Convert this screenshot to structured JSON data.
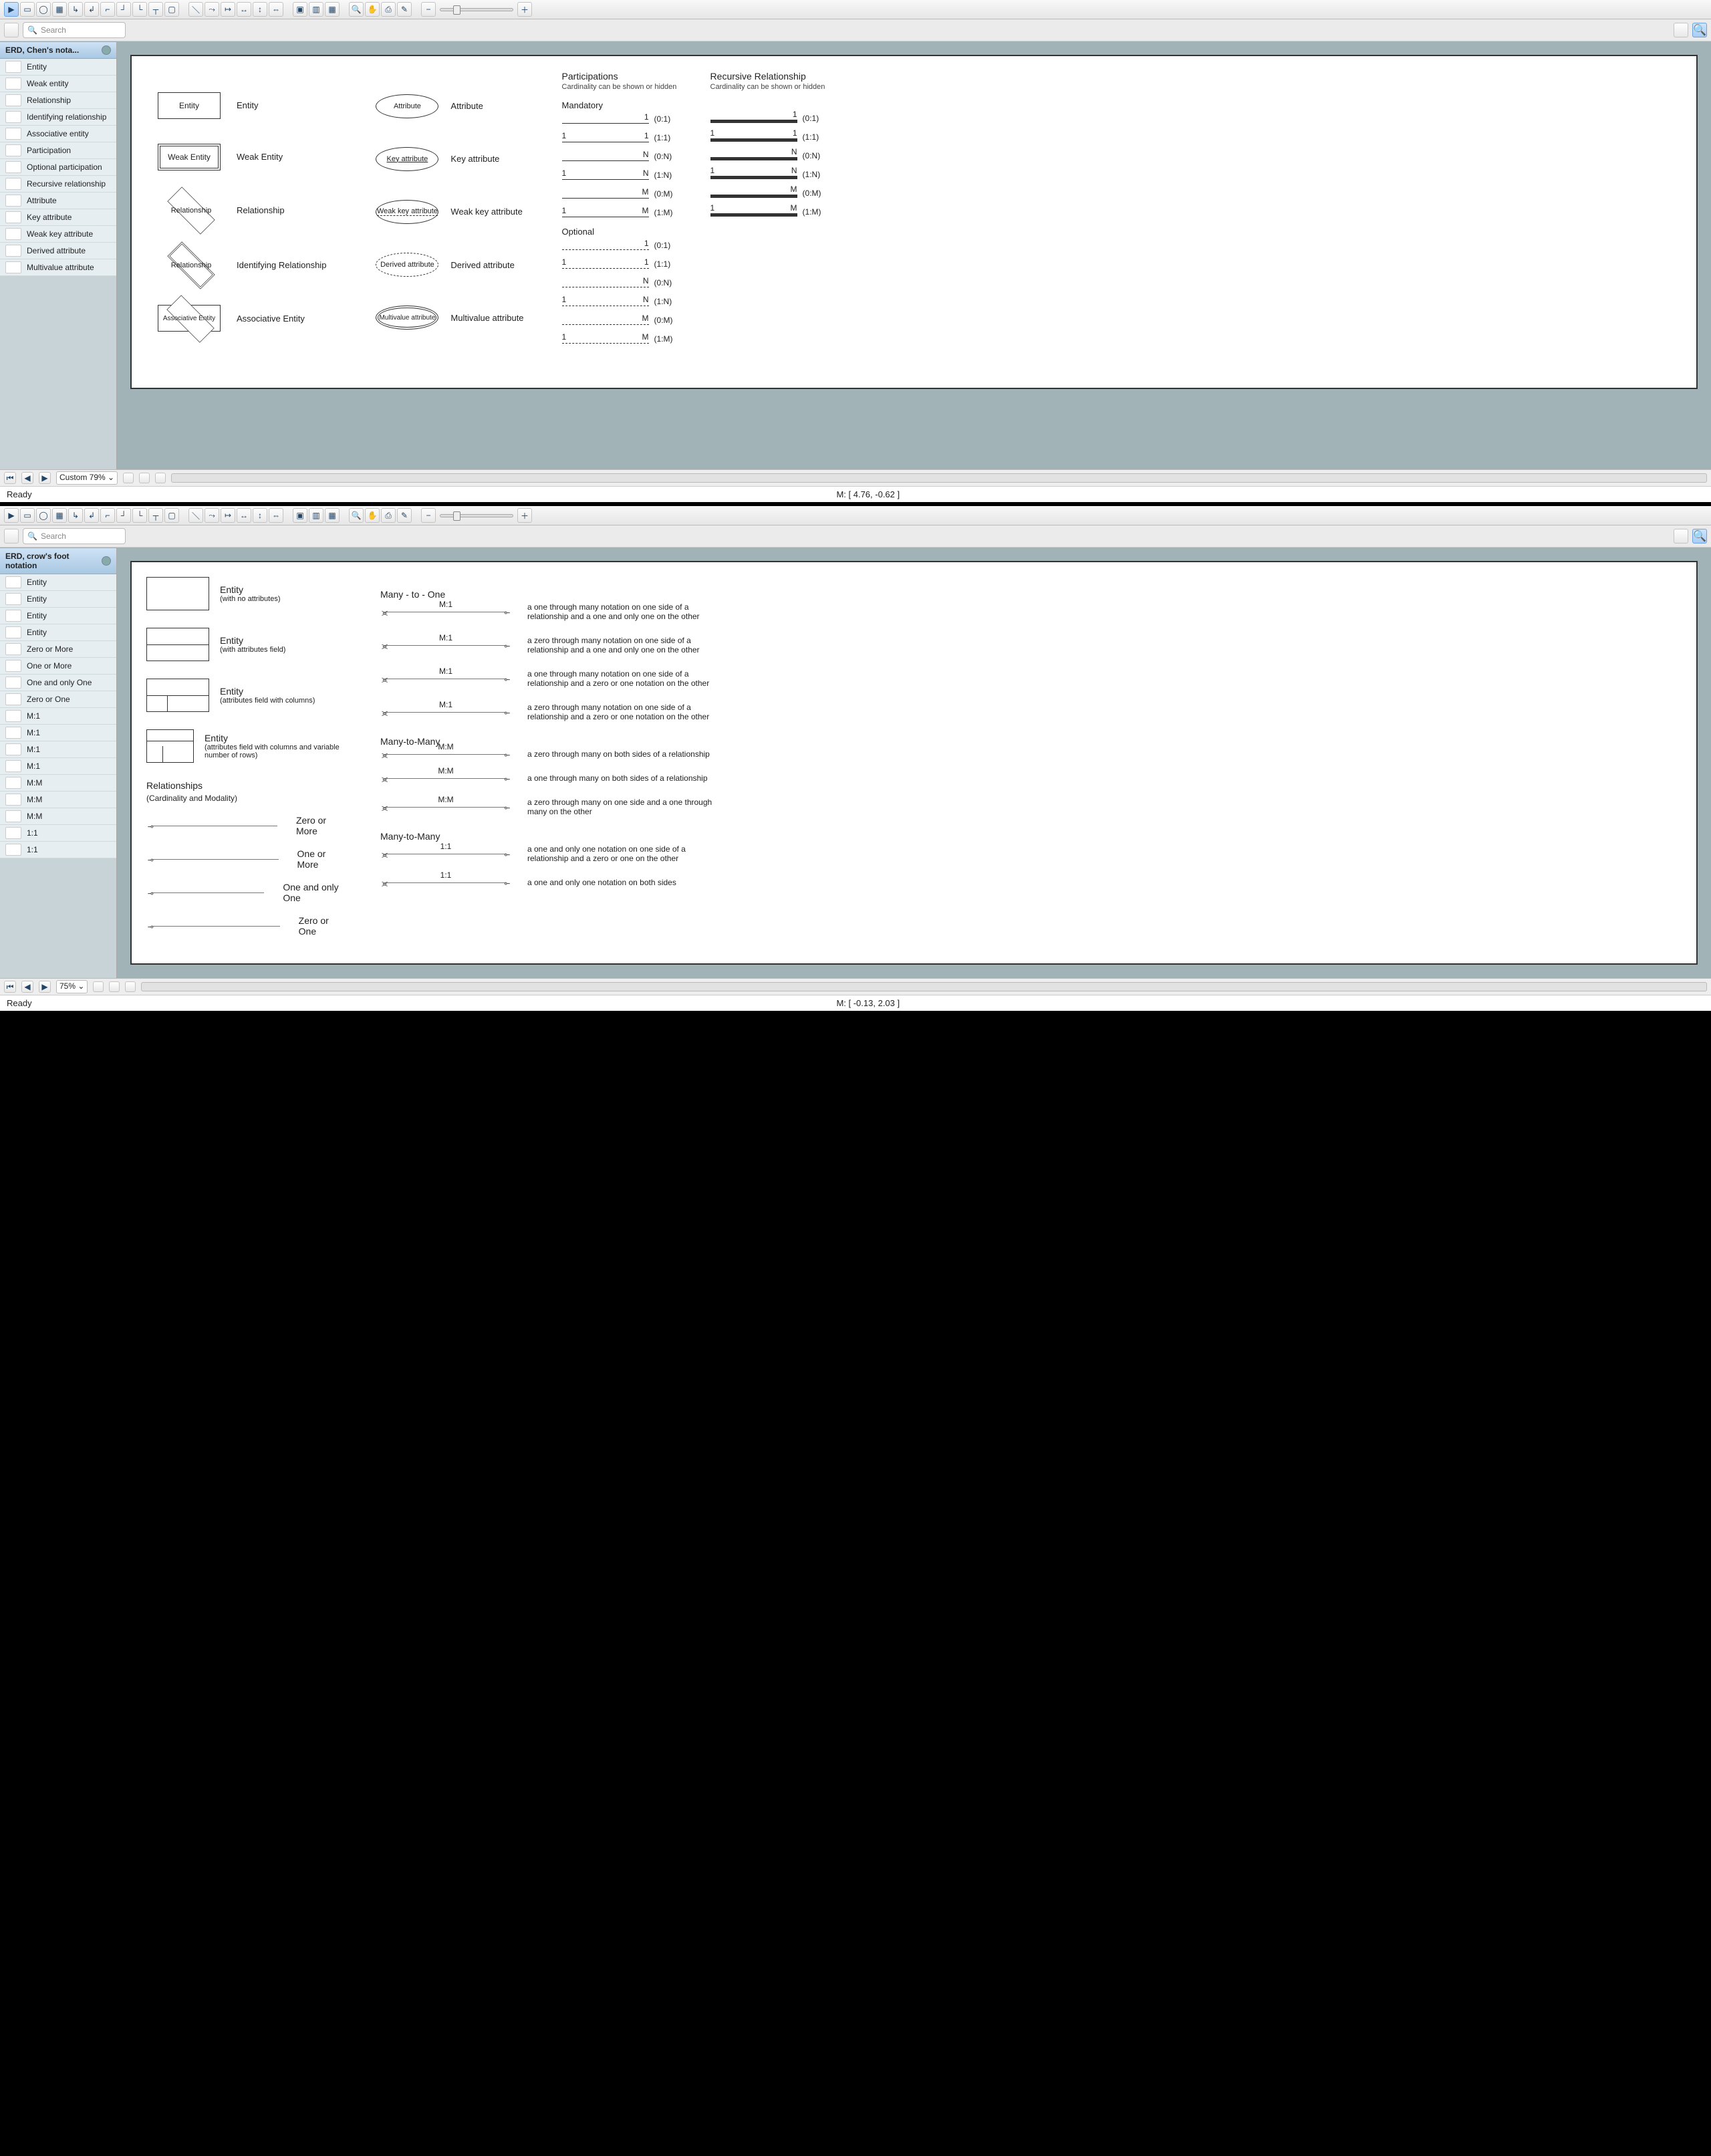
{
  "top": {
    "search_placeholder": "Search",
    "panel1_title": "ERD, Chen's nota...",
    "panel1_items": [
      "Entity",
      "Weak entity",
      "Relationship",
      "Identifying relationship",
      "Associative entity",
      "Participation",
      "Optional participation",
      "Recursive relationship",
      "Attribute",
      "Key attribute",
      "Weak key attribute",
      "Derived attribute",
      "Multivalue attribute"
    ],
    "zoom_label": "Custom 79%",
    "status_left": "Ready",
    "status_mid": "M: [ 4.76, -0.62 ]"
  },
  "canvas1": {
    "e1": "Entity",
    "l1": "Entity",
    "e2": "Weak Entity",
    "l2": "Weak Entity",
    "e3": "Relationship",
    "l3": "Relationship",
    "e4": "Relationship",
    "l4": "Identifying Relationship",
    "e5": "Associative Entity",
    "l5": "Associative Entity",
    "a1": "Attribute",
    "al1": "Attribute",
    "a2": "Key attribute",
    "al2": "Key attribute",
    "a3": "Weak key attribute",
    "al3": "Weak key attribute",
    "a4": "Derived attribute",
    "al4": "Derived attribute",
    "a5": "Multivalue attribute",
    "al5": "Multivalue attribute",
    "part_hdr": "Participations",
    "part_sub": "Cardinality can be shown or hidden",
    "rec_hdr": "Recursive Relationship",
    "rec_sub": "Cardinality can be shown or hidden",
    "mand": "Mandatory",
    "opt": "Optional",
    "cards": [
      {
        "l": "",
        "r": "1",
        "t": "(0:1)"
      },
      {
        "l": "1",
        "r": "1",
        "t": "(1:1)"
      },
      {
        "l": "",
        "r": "N",
        "t": "(0:N)"
      },
      {
        "l": "1",
        "r": "N",
        "t": "(1:N)"
      },
      {
        "l": "",
        "r": "M",
        "t": "(0:M)"
      },
      {
        "l": "1",
        "r": "M",
        "t": "(1:M)"
      }
    ],
    "opts": [
      {
        "l": "",
        "r": "1",
        "t": "(0:1)"
      },
      {
        "l": "1",
        "r": "1",
        "t": "(1:1)"
      },
      {
        "l": "",
        "r": "N",
        "t": "(0:N)"
      },
      {
        "l": "1",
        "r": "N",
        "t": "(1:N)"
      },
      {
        "l": "",
        "r": "M",
        "t": "(0:M)"
      },
      {
        "l": "1",
        "r": "M",
        "t": "(1:M)"
      }
    ]
  },
  "bot": {
    "search_placeholder": "Search",
    "panel_title": "ERD, crow's foot notation",
    "items": [
      "Entity",
      "Entity",
      "Entity",
      "Entity",
      "Zero or More",
      "One or More",
      "One and only One",
      "Zero or One",
      "M:1",
      "M:1",
      "M:1",
      "M:1",
      "M:M",
      "M:M",
      "M:M",
      "1:1",
      "1:1"
    ],
    "zoom": "75%",
    "status_left": "Ready",
    "status_mid": "M: [ -0.13, 2.03 ]"
  },
  "canvas2": {
    "ents": [
      {
        "h": "Entity",
        "s": "(with no attributes)"
      },
      {
        "h": "Entity",
        "s": "(with attributes field)"
      },
      {
        "h": "Entity",
        "s": "(attributes field with columns)"
      },
      {
        "h": "Entity",
        "s": "(attributes field with columns and variable number of rows)"
      }
    ],
    "rel_h": "Relationships",
    "rel_s": "(Cardinality and Modality)",
    "simple": [
      "Zero or More",
      "One or More",
      "One and only One",
      "Zero or One"
    ],
    "sec1": "Many - to - One",
    "m1": [
      {
        "l": "M:1",
        "d": "a one through many notation on one side of a relationship and a one and only one on the other"
      },
      {
        "l": "M:1",
        "d": "a zero through many notation on one side of a relationship and a one and only one on the other"
      },
      {
        "l": "M:1",
        "d": "a one through many notation on one side of a relationship and a zero or one notation on the other"
      },
      {
        "l": "M:1",
        "d": "a zero through many notation on one side of a relationship and a zero or one notation on the other"
      }
    ],
    "sec2": "Many-to-Many",
    "mm": [
      {
        "l": "M:M",
        "d": "a zero through many on both sides of a relationship"
      },
      {
        "l": "M:M",
        "d": "a one through many on both sides of a relationship"
      },
      {
        "l": "M:M",
        "d": "a zero through many on one side and a one through many on the other"
      }
    ],
    "sec3": "Many-to-Many",
    "one": [
      {
        "l": "1:1",
        "d": "a one and only one notation on one side of a relationship and a zero or one on the other"
      },
      {
        "l": "1:1",
        "d": "a one and only one notation on both sides"
      }
    ]
  }
}
